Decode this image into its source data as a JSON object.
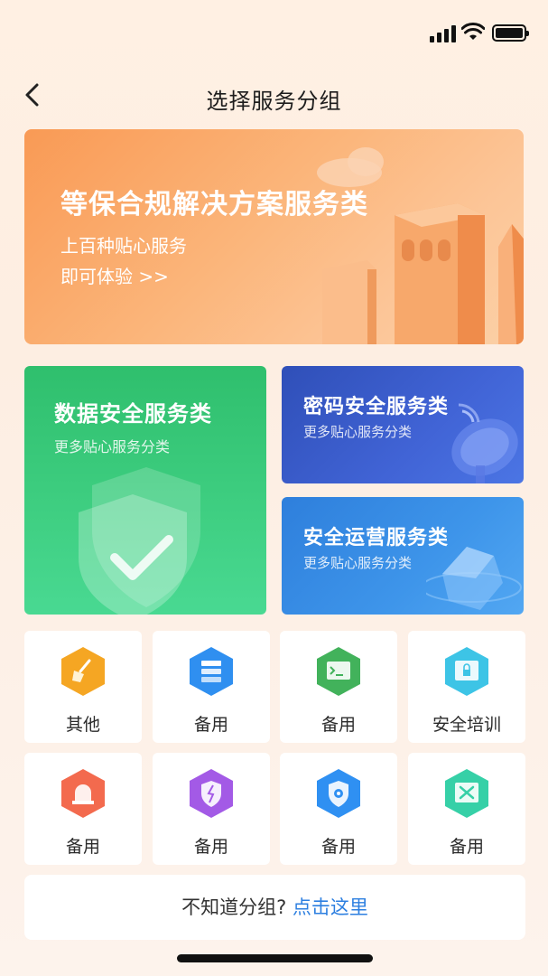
{
  "nav": {
    "title": "选择服务分组",
    "back_icon": "chevron-left-icon"
  },
  "banner": {
    "title": "等保合规解决方案服务类",
    "subtitle_line1": "上百种贴心服务",
    "subtitle_line2": "即可体验 >>",
    "colors": {
      "start": "#f99a55",
      "end": "#fbd0a6"
    }
  },
  "cards": [
    {
      "title": "数据安全服务类",
      "subtitle": "更多贴心服务分类",
      "color": "#2fbf6d",
      "icon": "shield-check-icon"
    },
    {
      "title": "密码安全服务类",
      "subtitle": "更多贴心服务分类",
      "color": "#3456c2",
      "icon": "satellite-dish-icon"
    },
    {
      "title": "安全运营服务类",
      "subtitle": "更多贴心服务分类",
      "color": "#3a8fe6",
      "icon": "crystal-icon"
    }
  ],
  "grid": [
    {
      "label": "其他",
      "icon": "broom-icon",
      "color": "#f5a623"
    },
    {
      "label": "备用",
      "icon": "server-icon",
      "color": "#2f8ff0"
    },
    {
      "label": "备用",
      "icon": "terminal-icon",
      "color": "#42b25b"
    },
    {
      "label": "安全培训",
      "icon": "secure-screen-icon",
      "color": "#3dc4e6"
    },
    {
      "label": "备用",
      "icon": "siren-icon",
      "color": "#f36a4e"
    },
    {
      "label": "备用",
      "icon": "broken-shield-icon",
      "color": "#a35ae6"
    },
    {
      "label": "备用",
      "icon": "gear-shield-icon",
      "color": "#2f90f2"
    },
    {
      "label": "备用",
      "icon": "tools-screen-icon",
      "color": "#36d0a7"
    }
  ],
  "help": {
    "question": "不知道分组?",
    "link": "点击这里"
  }
}
